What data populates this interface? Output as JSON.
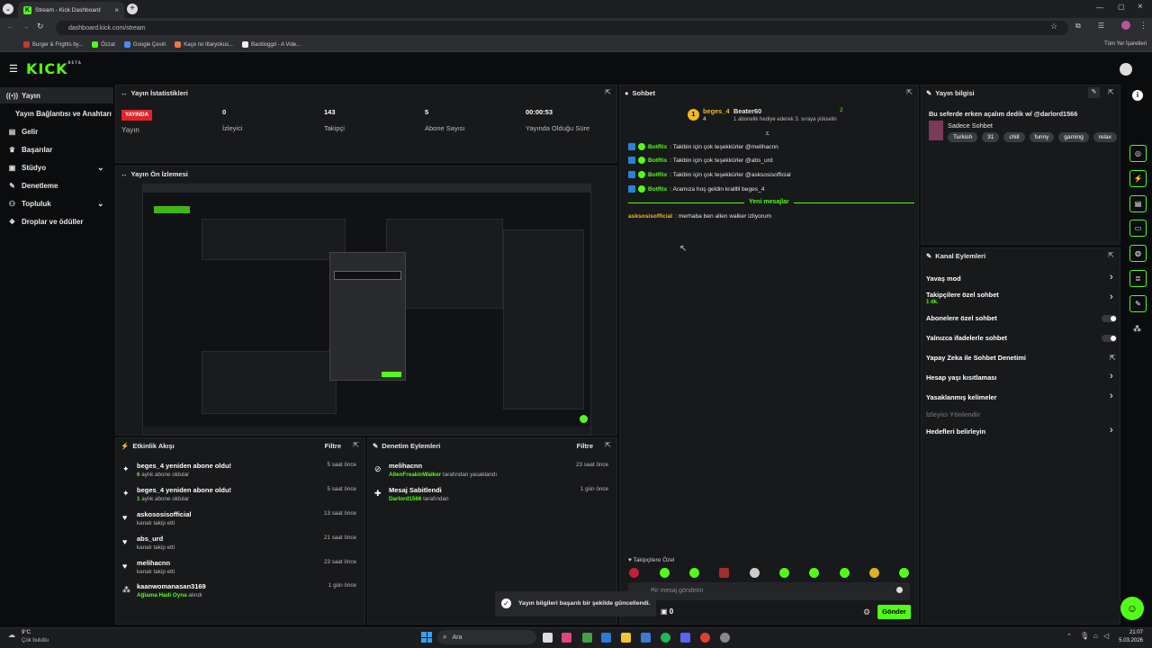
{
  "browser": {
    "tab_title": "Stream - Kick Dashboard",
    "url": "dashboard.kick.com/stream",
    "bookmarks": [
      "Burger & Frights by...",
      "Özzat",
      "Google Çeviri",
      "Kaçe no Ittaryokus...",
      "Backloggd - A Vide..."
    ],
    "all_bookmarks": "Tüm Yer İşaretleri"
  },
  "brand": {
    "logo": "KICK",
    "beta": "BETA",
    "accent": "#53fc18"
  },
  "sidebar": {
    "items": [
      {
        "label": "Yayın",
        "icon": "broadcast-icon"
      },
      {
        "label": "Yayın Bağlantısı ve Anahtarı",
        "icon": ""
      },
      {
        "label": "Gelir",
        "icon": "wallet-icon"
      },
      {
        "label": "Başarılar",
        "icon": "trophy-icon"
      },
      {
        "label": "Stüdyo",
        "icon": "studio-icon"
      },
      {
        "label": "Denetleme",
        "icon": "wrench-icon"
      },
      {
        "label": "Topluluk",
        "icon": "people-icon"
      },
      {
        "label": "Droplar ve ödüller",
        "icon": "gift-icon"
      }
    ]
  },
  "stats": {
    "title": "Yayın İstatistikleri",
    "live_badge": "YAYINDA",
    "items": [
      {
        "value": "0",
        "label": "İzleyici"
      },
      {
        "value": "143",
        "label": "Takipçi"
      },
      {
        "value": "5",
        "label": "Abone Sayısı"
      },
      {
        "value": "00:00:53",
        "label": "Yayında Olduğu Süre"
      }
    ],
    "status_label": "Yayın"
  },
  "preview": {
    "title": "Yayın Ön İzlemesi"
  },
  "activity": {
    "title": "Etkinlik Akışı",
    "filter": "Filtre",
    "rows": [
      {
        "icon": "sparkle-icon",
        "title": "beges_4 yeniden abone oldu!",
        "sub_hl": "6",
        "sub": " aylık abone oldular",
        "time": "5 saat önce"
      },
      {
        "icon": "sparkle-icon",
        "title": "beges_4 yeniden abone oldu!",
        "sub_hl": "1",
        "sub": " aylık abone oldular",
        "time": "5 saat önce"
      },
      {
        "icon": "heart-icon",
        "title": "askososisofficial",
        "sub_hl": "",
        "sub": "kanalı takip etti",
        "time": "13 saat önce"
      },
      {
        "icon": "heart-icon",
        "title": "abs_urd",
        "sub_hl": "",
        "sub": "kanalı takip etti",
        "time": "21 saat önce"
      },
      {
        "icon": "heart-icon",
        "title": "melihacnn",
        "sub_hl": "",
        "sub": "kanalı takip etti",
        "time": "23 saat önce"
      },
      {
        "icon": "reward-icon",
        "title": "kaanwomanasan3169",
        "sub_hl": "Ağlama Hadi Oyna",
        "sub": " alındı",
        "time": "1 gün önce"
      }
    ]
  },
  "moderation": {
    "title": "Denetim Eylemleri",
    "filter": "Filtre",
    "rows": [
      {
        "icon": "ban-icon",
        "title": "melihacnn",
        "sub_hl": "AllenFreakinWalker",
        "sub": " tarafından yasaklandı",
        "time": "23 saat önce"
      },
      {
        "icon": "pin-icon",
        "title": "Mesaj Sabitlendi",
        "sub_hl": "Darlord1566",
        "sub": " tarafından",
        "time": "1 gün önce"
      }
    ]
  },
  "chat": {
    "title": "Sohbet",
    "top_gifter": {
      "rank": "1",
      "name": "beges_4",
      "count": "4"
    },
    "gifter2": {
      "name": "Beater60",
      "count": "2",
      "note": "1 abonelik hediye ederek 3. sıraya yükselin"
    },
    "messages": [
      {
        "user": "BotRix",
        "text": ": Takibin için çok teşekkürler @melihacnn"
      },
      {
        "user": "BotRix",
        "text": ": Takibin için çok teşekkürler @abs_urd"
      },
      {
        "user": "BotRix",
        "text": ": Takibin için çok teşekkürler @asksosisofficial"
      },
      {
        "user": "BotRix",
        "text": ": Aramıza hoş geldin kralllll beges_4"
      }
    ],
    "new_messages": "Yeni mesajlar",
    "new_msg": {
      "user": "asksosisofficial",
      "text": ": merhaba ben allen walker izliyorum"
    },
    "followers_only": "Takipçilere Özel",
    "input_placeholder": "Bir mesaj gönderin",
    "count": "0",
    "send": "Gönder"
  },
  "stream_info": {
    "title": "Yayın bilgisi",
    "stream_title": "Bu seferde erken açalım dedik w/ @darlord1566",
    "category": "Sadece Sohbet",
    "tags": [
      "Turkish",
      "31",
      "chill",
      "funny",
      "gaming",
      "relax"
    ]
  },
  "channel_actions": {
    "title": "Kanal Eylemleri",
    "rows": [
      {
        "label": "Yavaş mod",
        "control": "chevron"
      },
      {
        "label": "Takipçilere özel sohbet",
        "sub": "1 dk.",
        "control": "chevron"
      },
      {
        "label": "Abonelere özel sohbet",
        "control": "toggle"
      },
      {
        "label": "Yalnızca ifadelerle sohbet",
        "control": "toggle"
      },
      {
        "label": "Yapay Zeka ile Sohbet Denetimi",
        "control": "external"
      },
      {
        "label": "Hesap yaşı kısıtlaması",
        "control": "chevron"
      },
      {
        "label": "Yasaklanmış kelimeler",
        "control": "chevron"
      },
      {
        "label": "İzleyici Yönlendir",
        "control": "none"
      },
      {
        "label": "Hedefleri belirleyin",
        "control": "chevron"
      }
    ]
  },
  "toast": {
    "text": "Yayın bilgileri başarılı bir şekilde güncellendi."
  },
  "taskbar": {
    "weather_temp": "9°C",
    "weather_desc": "Çok bulutlu",
    "search": "Ara",
    "time": "21:07",
    "date": "5.03.2026"
  }
}
